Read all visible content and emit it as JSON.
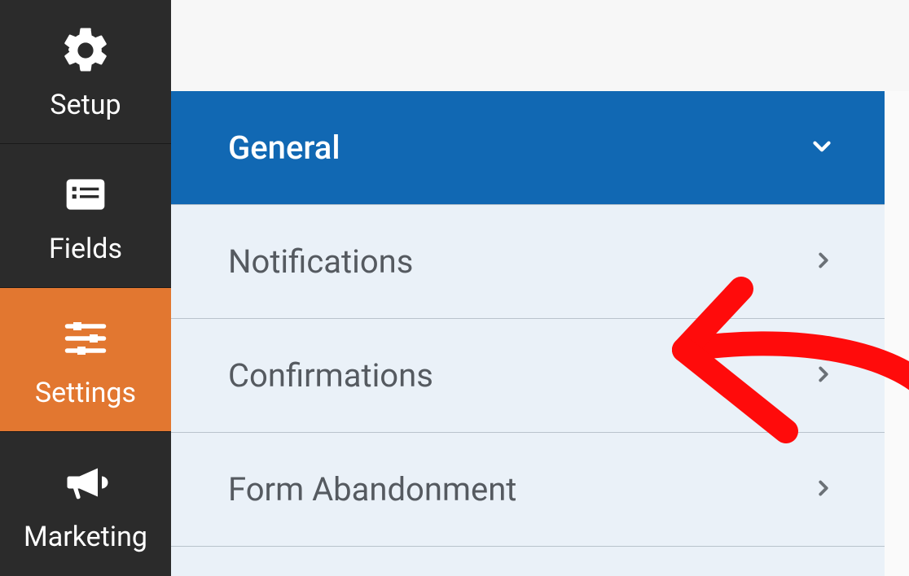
{
  "sidebar": {
    "items": [
      {
        "label": "Setup",
        "icon": "gear-icon",
        "active": false
      },
      {
        "label": "Fields",
        "icon": "list-icon",
        "active": false
      },
      {
        "label": "Settings",
        "icon": "sliders-icon",
        "active": true
      },
      {
        "label": "Marketing",
        "icon": "megaphone-icon",
        "active": false
      }
    ]
  },
  "settings_panel": {
    "items": [
      {
        "label": "General",
        "expanded": true
      },
      {
        "label": "Notifications",
        "expanded": false
      },
      {
        "label": "Confirmations",
        "expanded": false
      },
      {
        "label": "Form Abandonment",
        "expanded": false
      }
    ]
  },
  "annotation": {
    "type": "arrow",
    "color": "#ff0b0b",
    "points_to": "Confirmations"
  }
}
